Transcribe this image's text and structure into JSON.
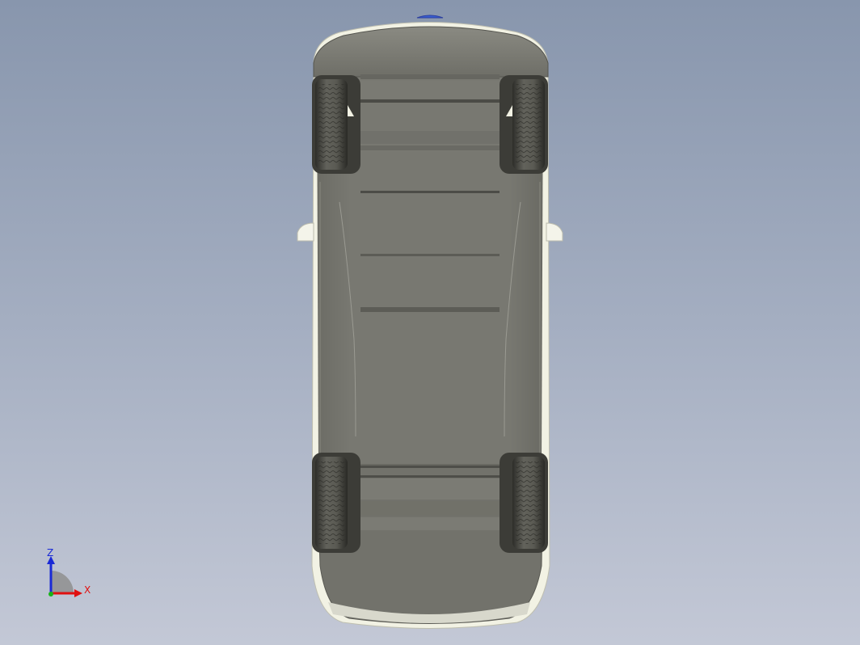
{
  "viewport": {
    "background_top": "#8896ad",
    "background_bottom": "#c3c8d6",
    "model": {
      "view": "bottom",
      "body_color": "#777770",
      "tire_color": "#4c4c46",
      "trim_color": "#f2f2e4",
      "wheels": [
        "front-left",
        "front-right",
        "rear-left",
        "rear-right"
      ]
    }
  },
  "triad": {
    "x_label": "X",
    "z_label": "Z",
    "x_color": "#e01010",
    "z_color": "#1a2ad6",
    "y_color": "#18b418"
  }
}
